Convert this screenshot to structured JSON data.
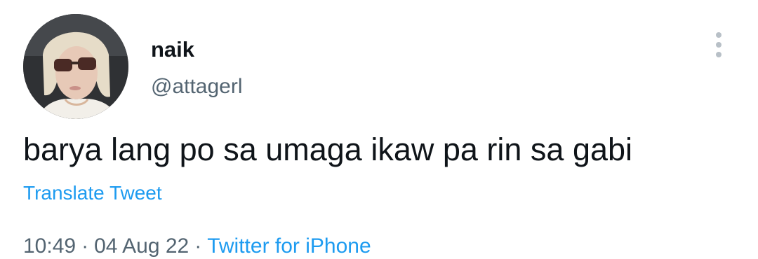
{
  "tweet": {
    "display_name": "naik",
    "handle": "@attagerl",
    "text": "barya lang po sa umaga ikaw pa rin sa gabi",
    "translate_label": "Translate Tweet",
    "time": "10:49",
    "separator": "·",
    "date": "04 Aug 22",
    "source": "Twitter for iPhone"
  },
  "icons": {
    "more": "more-options-icon"
  },
  "colors": {
    "link": "#1d9bf0",
    "secondary_text": "#536471",
    "primary_text": "#0f1419"
  }
}
